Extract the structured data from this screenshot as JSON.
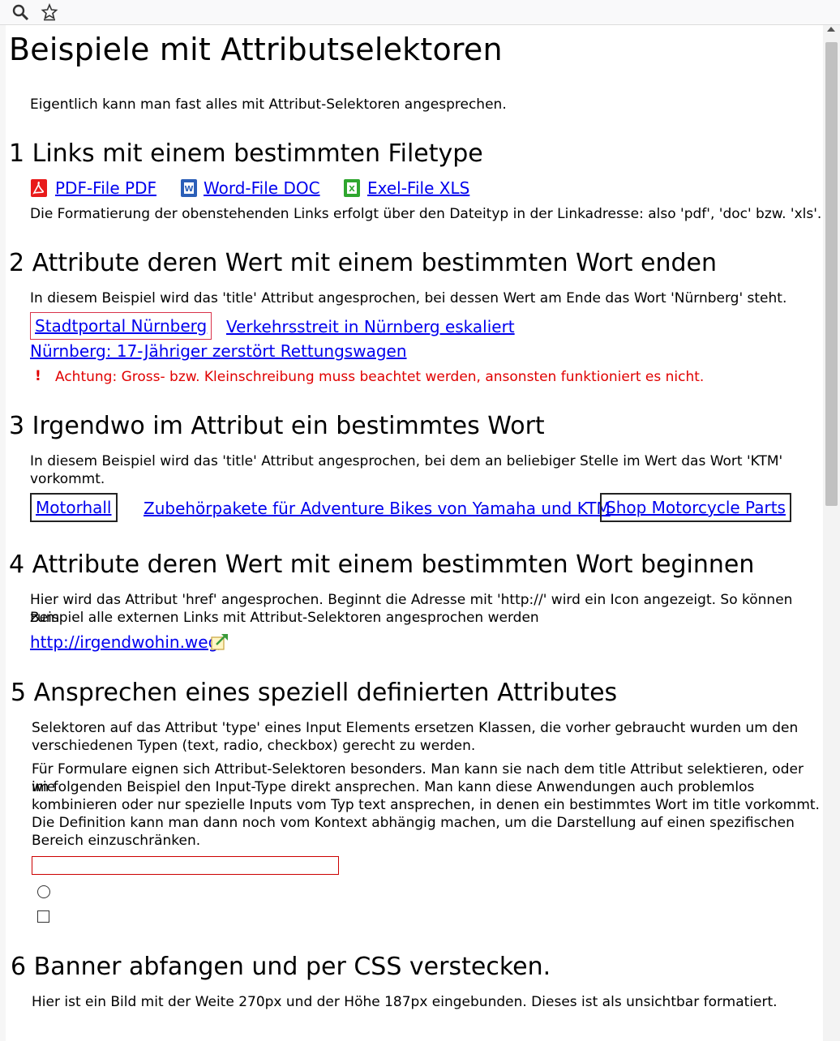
{
  "toolbar": {
    "icons": [
      "search-icon",
      "bookmark-star-icon"
    ]
  },
  "page": {
    "title": "Beispiele mit Attributselektoren",
    "intro": "Eigentlich kann man fast alles mit Attribut-Selektoren angesprechen."
  },
  "s1": {
    "heading": "1 Links mit einem bestimmten Filetype",
    "links": [
      "PDF-File PDF",
      "Word-File DOC",
      "Exel-File XLS"
    ],
    "text": "Die Formatierung der obenstehenden Links erfolgt über den Dateityp in der Linkadresse: also 'pdf', 'doc' bzw. 'xls'."
  },
  "s2": {
    "heading": "2 Attribute deren Wert mit einem bestimmten Wort enden",
    "text": "In diesem Beispiel wird das 'title' Attribut angesprochen, bei dessen Wert am Ende das Wort 'Nürnberg' steht.",
    "links": [
      "Stadtportal Nürnberg",
      "Verkehrsstreit in Nürnberg eskaliert",
      "Nürnberg: 17-Jähriger zerstört Rettungswagen"
    ],
    "warning_mark": "!",
    "warning": "Achtung: Gross- bzw. Kleinschreibung muss beachtet werden, ansonsten funktioniert es nicht."
  },
  "s3": {
    "heading": "3 Irgendwo im Attribut ein bestimmtes Wort",
    "text_line1": "In diesem Beispiel wird das 'title' Attribut angesprochen, bei dem an beliebiger Stelle im Wert das Wort 'KTM'",
    "text_line2": "vorkommt.",
    "links": [
      "Motorhall",
      "Zubehörpakete für Adventure Bikes von Yamaha und KTM",
      "Shop Motorcycle Parts"
    ]
  },
  "s4": {
    "heading": "4 Attribute deren Wert mit einem bestimmten Wort beginnen",
    "text_line1": "Hier wird das Attribut 'href' angesprochen. Beginnt die Adresse mit 'http://' wird ein Icon angezeigt. So können zum",
    "text_line2": "Beispiel alle externen Links mit Attribut-Selektoren angesprochen werden",
    "link": "http://irgendwohin.weg"
  },
  "s5": {
    "heading": "5 Ansprechen eines speziell definierten Attributes",
    "p1_line1": "Selektoren auf das Attribut 'type' eines Input Elements ersetzen Klassen, die vorher gebraucht wurden um den",
    "p1_line2": "verschiedenen Typen (text, radio, checkbox) gerecht zu werden.",
    "p2_line1": "Für Formulare eignen sich Attribut-Selektoren besonders. Man kann sie nach dem title Attribut selektieren, oder wie",
    "p2_line2": "im folgenden Beispiel den Input-Type direkt ansprechen. Man kann diese Anwendungen auch problemlos",
    "p2_line3": "kombinieren oder nur spezielle Inputs vom Typ text ansprechen, in denen ein bestimmtes Wort im title vorkommt.",
    "p2_line4": "Die Definition kann man dann noch vom Kontext abhängig machen, um die Darstellung auf einen spezifischen",
    "p2_line5": "Bereich einzuschränken.",
    "text_input_value": ""
  },
  "s6": {
    "heading": "6 Banner abfangen und per CSS verstecken.",
    "text": "Hier ist ein Bild mit der Weite 270px und der Höhe 187px eingebunden. Dieses ist als unsichtbar formatiert."
  },
  "colors": {
    "link": "#0000ee",
    "warning": "#e00000",
    "red_border": "#d9334a"
  }
}
